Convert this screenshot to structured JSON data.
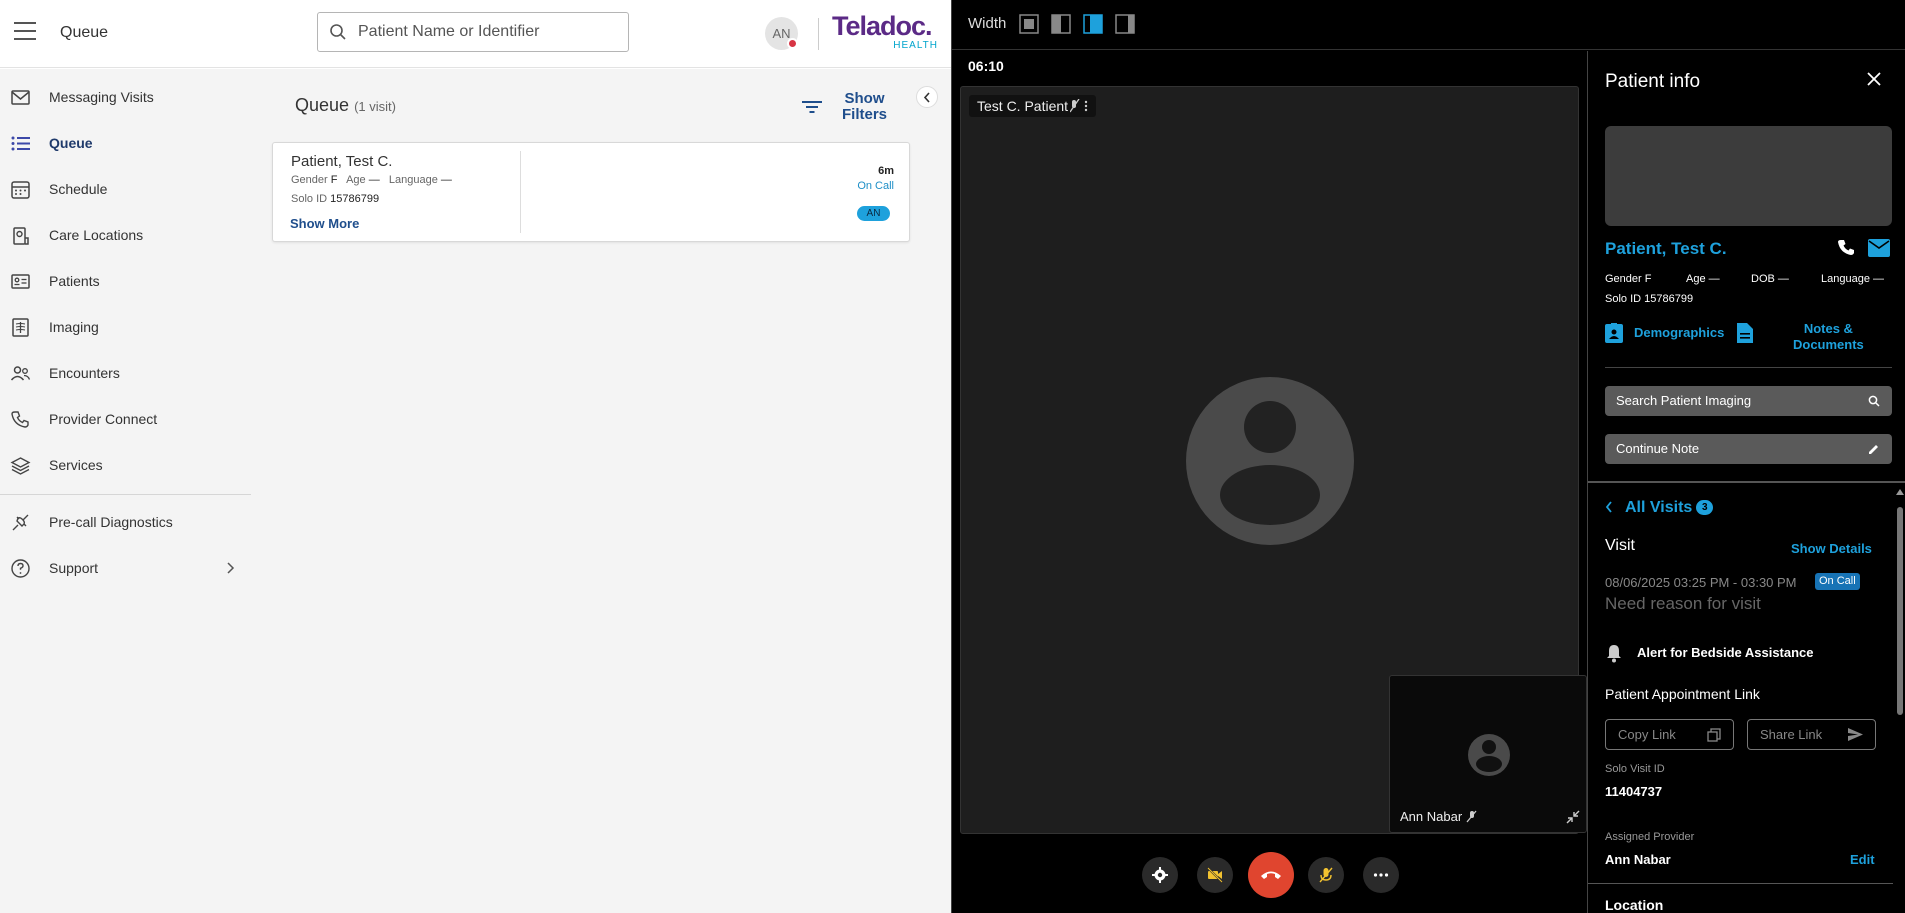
{
  "app": {
    "title": "Queue",
    "search_placeholder": "Patient Name or Identifier",
    "user_initials": "AN",
    "logo": {
      "line1": "Teladoc.",
      "line2": "HEALTH"
    }
  },
  "sidebar": {
    "items": [
      {
        "label": "Messaging Visits",
        "icon": "mail-icon"
      },
      {
        "label": "Queue",
        "icon": "list-icon",
        "active": true
      },
      {
        "label": "Schedule",
        "icon": "calendar-icon"
      },
      {
        "label": "Care Locations",
        "icon": "location-icon"
      },
      {
        "label": "Patients",
        "icon": "id-card-icon"
      },
      {
        "label": "Imaging",
        "icon": "imaging-icon"
      },
      {
        "label": "Encounters",
        "icon": "people-icon"
      },
      {
        "label": "Provider Connect",
        "icon": "phone-icon"
      },
      {
        "label": "Services",
        "icon": "layers-icon"
      },
      {
        "label": "Pre-call Diagnostics",
        "icon": "plug-icon"
      },
      {
        "label": "Support",
        "icon": "help-icon"
      }
    ]
  },
  "queue": {
    "title": "Queue",
    "count": "(1 visit)",
    "filters_label_1": "Show",
    "filters_label_2": "Filters",
    "card": {
      "name": "Patient, Test C.",
      "gender_label": "Gender",
      "gender": "F",
      "age_label": "Age",
      "age": "—",
      "language_label": "Language",
      "language": "—",
      "solo_label": "Solo ID",
      "solo_id": "15786799",
      "show_more": "Show More",
      "time": "6m",
      "status": "On Call",
      "badge": "AN"
    }
  },
  "video": {
    "width_label": "Width",
    "timer": "06:10",
    "remote_name": "Test C. Patient",
    "self_name": "Ann Nabar"
  },
  "patient_info": {
    "title": "Patient info",
    "name": "Patient, Test C.",
    "gender_label": "Gender",
    "gender": "F",
    "age_label": "Age",
    "age": "—",
    "dob_label": "DOB",
    "dob": "—",
    "language_label": "Language",
    "language": "—",
    "solo_label": "Solo ID",
    "solo_id": "15786799",
    "tab_demographics": "Demographics",
    "tab_notes_1": "Notes &",
    "tab_notes_2": "Documents",
    "search_imaging": "Search Patient Imaging",
    "continue_note": "Continue Note",
    "all_visits": "All Visits",
    "all_visits_count": "3",
    "visit_label": "Visit",
    "show_details": "Show Details",
    "visit_time": "08/06/2025 03:25 PM - 03:30 PM",
    "visit_status": "On Call",
    "reason": "Need reason for visit",
    "alert": "Alert for Bedside Assistance",
    "appt_link_label": "Patient Appointment Link",
    "copy_link": "Copy Link",
    "share_link": "Share Link",
    "solo_visit_label": "Solo Visit ID",
    "solo_visit_id": "11404737",
    "assigned_label": "Assigned Provider",
    "assigned": "Ann Nabar",
    "edit": "Edit",
    "cut_label": "Location"
  },
  "colors": {
    "accent": "#1ea1dc",
    "nav_active": "#1f3a6b",
    "hangup": "#e0452f",
    "brand": "#5b2a86"
  }
}
